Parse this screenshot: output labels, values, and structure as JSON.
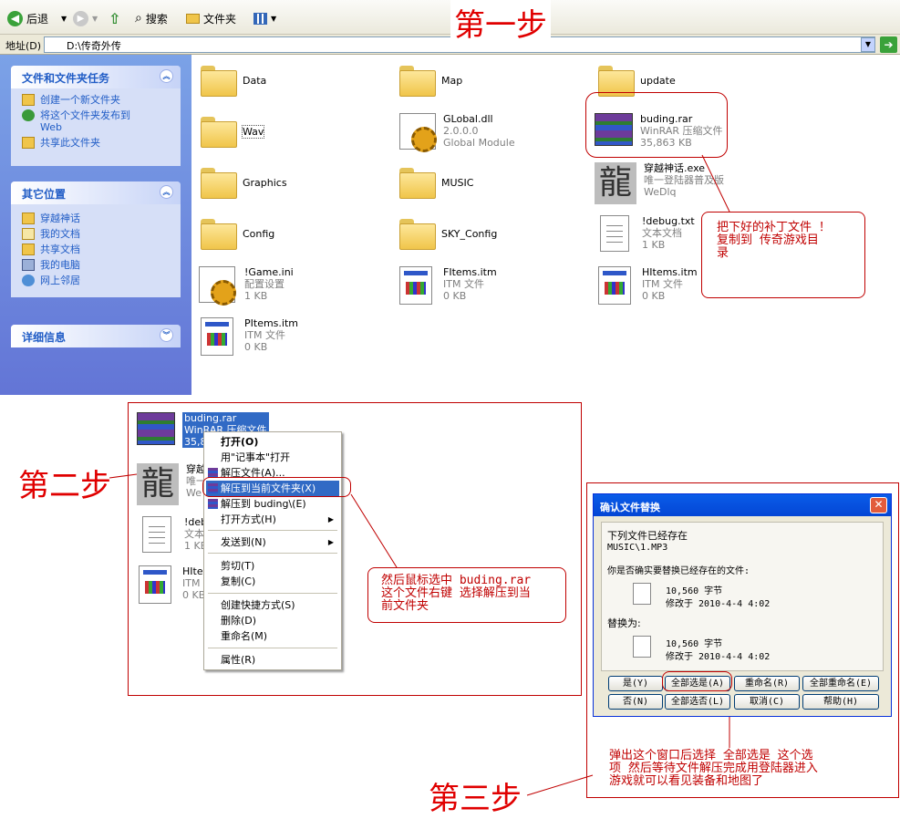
{
  "toolbar": {
    "back": "后退",
    "search": "搜索",
    "folders": "文件夹"
  },
  "address": {
    "label": "地址(D)",
    "value": "D:\\传奇外传"
  },
  "left_panel": {
    "tasks_title": "文件和文件夹任务",
    "tasks": [
      "创建一个新文件夹",
      "将这个文件夹发布到",
      "Web",
      "共享此文件夹"
    ],
    "places_title": "其它位置",
    "places": [
      "穿越神话",
      "我的文档",
      "共享文档",
      "我的电脑",
      "网上邻居"
    ],
    "details_title": "详细信息"
  },
  "files": [
    {
      "name": "Data"
    },
    {
      "name": "Map"
    },
    {
      "name": "update"
    },
    {
      "name": "Wav"
    },
    {
      "name": "GLobal.dll",
      "line2": "2.0.0.0",
      "line3": "Global Module"
    },
    {
      "name": "buding.rar",
      "line2": "WinRAR 压缩文件",
      "line3": "35,863 KB"
    },
    {
      "name": "Graphics"
    },
    {
      "name": "MUSIC"
    },
    {
      "name": "穿越神话.exe",
      "line2": "唯一登陆器普及版",
      "line3": "WeDlq"
    },
    {
      "name": "Config"
    },
    {
      "name": "SKY_Config"
    },
    {
      "name": "!debug.txt",
      "line2": "文本文档",
      "line3": "1 KB"
    },
    {
      "name": "!Game.ini",
      "line2": "配置设置",
      "line3": "1 KB"
    },
    {
      "name": "FItems.itm",
      "line2": "ITM 文件",
      "line3": "0 KB"
    },
    {
      "name": "HItems.itm",
      "line2": "ITM 文件",
      "line3": "0 KB"
    },
    {
      "name": "PItems.itm",
      "line2": "ITM 文件",
      "line3": "0 KB"
    }
  ],
  "dragon_glyph": "龍",
  "annotations": {
    "step1": "第一步",
    "step2": "第二步",
    "step3": "第三步",
    "note1": [
      "把下好的补丁文件 ！",
      "复制到 传奇游戏目",
      "录"
    ],
    "note2": [
      "然后鼠标选中 buding.rar",
      "这个文件右键 选择解压到当",
      "前文件夹"
    ],
    "note3": [
      "弹出这个窗口后选择  全部选是  这个选",
      "项  然后等待文件解压完成用登陆器进入",
      "游戏就可以看见装备和地图了"
    ]
  },
  "step2_files": [
    {
      "name": "buding.rar",
      "line2": "WinRAR 压缩文件",
      "line3": "35,8"
    },
    {
      "name": "穿越",
      "line2": "唯一",
      "line3": "We"
    },
    {
      "name": "!deb",
      "line2": "文本",
      "line3": "1 KB"
    },
    {
      "name": "HIte",
      "line2": "ITM",
      "line3": "0 KB"
    }
  ],
  "context_menu": {
    "items": [
      "打开(O)",
      "用\"记事本\"打开",
      "解压文件(A)...",
      "解压到当前文件夹(X)",
      "解压到 buding\\(E)",
      "打开方式(H)",
      "发送到(N)",
      "剪切(T)",
      "复制(C)",
      "创建快捷方式(S)",
      "删除(D)",
      "重命名(M)",
      "属性(R)"
    ],
    "highlighted": "解压到当前文件夹(X)"
  },
  "dialog": {
    "title": "确认文件替换",
    "exists": "下列文件已经存在",
    "path": "MUSIC\\1.MP3",
    "question": "你是否确实要替换已经存在的文件:",
    "size1": "10,560 字节",
    "mod1": "修改于 2010-4-4 4:02",
    "replace_with": "替换为:",
    "size2": "10,560 字节",
    "mod2": "修改于 2010-4-4 4:02",
    "buttons": [
      "是(Y)",
      "全部选是(A)",
      "重命名(R)",
      "全部重命名(E)",
      "否(N)",
      "全部选否(L)",
      "取消(C)",
      "帮助(H)"
    ]
  }
}
